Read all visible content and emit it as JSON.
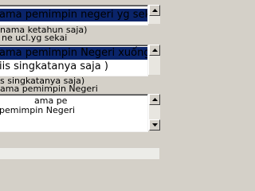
{
  "field1": {
    "line1": "ama pemimpin negeri yg seka",
    "ghost1": "nama ketahun saja)",
    "ghost2": "ne ucl.yg sekai"
  },
  "field2": {
    "line1": "ama pemimpin Negeri xuống N",
    "line2": "iis singkatanya saja )",
    "ghost1": "ama pemimpin Negeri",
    "ghost2": "s singkatanya saja)"
  },
  "field3": {
    "ghost1": "ama pe",
    "ghost2": "pemimpin Negeri"
  }
}
